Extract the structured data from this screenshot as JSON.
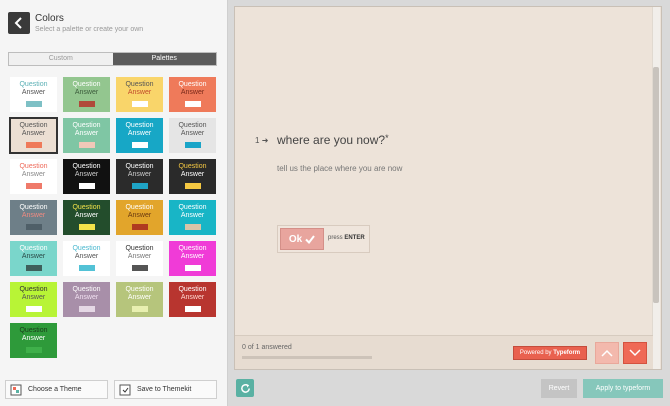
{
  "header": {
    "title": "Colors",
    "subtitle": "Select a palette or create your own"
  },
  "tabs": {
    "custom": "Custom",
    "palettes": "Palettes"
  },
  "palettes": [
    {
      "q": "Question",
      "a": "Answer",
      "bg": "#ffffff",
      "qc": "#5bb0b5",
      "ac": "#555555",
      "sw": "#7ec0c5"
    },
    {
      "q": "Question",
      "a": "Answer",
      "bg": "#93c68f",
      "qc": "#ffffff",
      "ac": "#3c5c3c",
      "sw": "#b04a3a"
    },
    {
      "q": "Question",
      "a": "Answer",
      "bg": "#f9d56a",
      "qc": "#555555",
      "ac": "#c24a2c",
      "sw": "#ffffff"
    },
    {
      "q": "Question",
      "a": "Answer",
      "bg": "#ef7a5a",
      "qc": "#ffffff",
      "ac": "#7a2a1a",
      "sw": "#ffffff"
    },
    {
      "q": "Question",
      "a": "Answer",
      "bg": "#ecdfd3",
      "qc": "#555555",
      "ac": "#555555",
      "sw": "#ef7a5a",
      "selected": true
    },
    {
      "q": "Question",
      "a": "Answer",
      "bg": "#7fc6a4",
      "qc": "#ffffff",
      "ac": "#ffffff",
      "sw": "#f0c8b8"
    },
    {
      "q": "Question",
      "a": "Answer",
      "bg": "#17a7c6",
      "qc": "#ffffff",
      "ac": "#ffffff",
      "sw": "#ffffff"
    },
    {
      "q": "Question",
      "a": "Answer",
      "bg": "#e5e5e5",
      "qc": "#555555",
      "ac": "#555555",
      "sw": "#19a4c8"
    },
    {
      "q": "Question",
      "a": "Answer",
      "bg": "#ffffff",
      "qc": "#ef6a5a",
      "ac": "#888888",
      "sw": "#ef7a6a"
    },
    {
      "q": "Question",
      "a": "Answer",
      "bg": "#111111",
      "qc": "#ffffff",
      "ac": "#cccccc",
      "sw": "#ffffff"
    },
    {
      "q": "Question",
      "a": "Answer",
      "bg": "#2b2b2b",
      "qc": "#ffffff",
      "ac": "#cccccc",
      "sw": "#1fa4c6"
    },
    {
      "q": "Question",
      "a": "Answer",
      "bg": "#2a2a2a",
      "qc": "#f5c842",
      "ac": "#ffffff",
      "sw": "#f5c842"
    },
    {
      "q": "Question",
      "a": "Answer",
      "bg": "#6e7f88",
      "qc": "#ffffff",
      "ac": "#f08a80",
      "sw": "#4f5f68"
    },
    {
      "q": "Question",
      "a": "Answer",
      "bg": "#234d2c",
      "qc": "#f3e34a",
      "ac": "#ffffff",
      "sw": "#f3e34a"
    },
    {
      "q": "Question",
      "a": "Answer",
      "bg": "#e2a52b",
      "qc": "#ffffff",
      "ac": "#6a3a10",
      "sw": "#b03a20"
    },
    {
      "q": "Question",
      "a": "Answer",
      "bg": "#18b5c6",
      "qc": "#ffffff",
      "ac": "#ffffff",
      "sw": "#d9c4a8"
    },
    {
      "q": "Question",
      "a": "Answer",
      "bg": "#7ad6cb",
      "qc": "#ffffff",
      "ac": "#2b4b48",
      "sw": "#3f5f5b"
    },
    {
      "q": "Question",
      "a": "Answer",
      "bg": "#ffffff",
      "qc": "#4ab8cf",
      "ac": "#555555",
      "sw": "#53c2d6"
    },
    {
      "q": "Question",
      "a": "Answer",
      "bg": "#ffffff",
      "qc": "#333333",
      "ac": "#777777",
      "sw": "#555555"
    },
    {
      "q": "Question",
      "a": "Answer",
      "bg": "#f03bd7",
      "qc": "#ffffff",
      "ac": "#ffffff",
      "sw": "#ffffff"
    },
    {
      "q": "Question",
      "a": "Answer",
      "bg": "#b8f436",
      "qc": "#333333",
      "ac": "#555555",
      "sw": "#ffffff"
    },
    {
      "q": "Question",
      "a": "Answer",
      "bg": "#a88fa9",
      "qc": "#ffffff",
      "ac": "#f0e0f0",
      "sw": "#e5d8e5"
    },
    {
      "q": "Question",
      "a": "Answer",
      "bg": "#b6c57c",
      "qc": "#ffffff",
      "ac": "#ffffff",
      "sw": "#e8f0b0"
    },
    {
      "q": "Question",
      "a": "Answer",
      "bg": "#b8352f",
      "qc": "#ffffff",
      "ac": "#ffd7d0",
      "sw": "#ffffff"
    },
    {
      "q": "Question",
      "a": "Answer",
      "bg": "#2e9a3a",
      "qc": "#1a3a1a",
      "ac": "#ffffff",
      "sw": "#3fb04a"
    }
  ],
  "actions": {
    "theme": "Choose a Theme",
    "save": "Save to Themekit"
  },
  "preview": {
    "number": "1",
    "question": "where are you now?",
    "required_mark": "*",
    "description": "tell us the place where you are now",
    "ok_label": "Ok",
    "press": "press",
    "enter": "ENTER",
    "progress_text": "0 of 1 answered",
    "powered": "Powered by",
    "brand": "Typeform"
  },
  "bottom": {
    "revert": "Revert",
    "apply": "Apply to typeform"
  },
  "colors": {
    "accent": "#ef6955",
    "teal": "#5ab1a3"
  }
}
